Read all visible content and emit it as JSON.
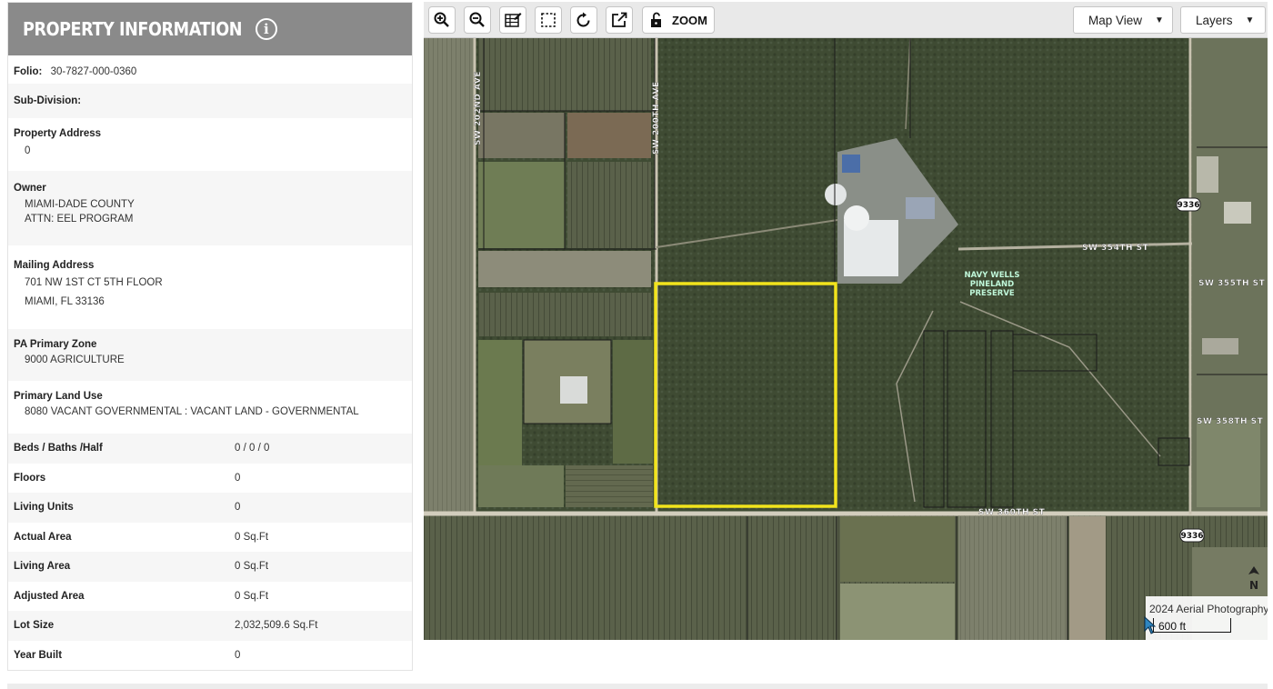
{
  "panel": {
    "title": "PROPERTY INFORMATION",
    "info_icon": "info-circle-icon",
    "folio_label": "Folio:",
    "folio_value": "30-7827-000-0360",
    "subdivision_label": "Sub-Division:",
    "property_address_label": "Property Address",
    "property_address_value": "0",
    "owner_label": "Owner",
    "owner_lines": [
      "MIAMI-DADE COUNTY",
      "ATTN: EEL PROGRAM"
    ],
    "mailing_label": "Mailing Address",
    "mailing_lines": [
      "701 NW 1ST CT 5TH FLOOR",
      "MIAMI, FL 33136"
    ],
    "zone_label": "PA Primary Zone",
    "zone_value": "9000 AGRICULTURE",
    "land_use_label": "Primary Land Use",
    "land_use_value": "8080 VACANT GOVERNMENTAL : VACANT LAND - GOVERNMENTAL",
    "details": [
      {
        "label": "Beds / Baths /Half",
        "value": "0 / 0 / 0"
      },
      {
        "label": "Floors",
        "value": "0"
      },
      {
        "label": "Living Units",
        "value": "0"
      },
      {
        "label": "Actual Area",
        "value": "0 Sq.Ft"
      },
      {
        "label": "Living Area",
        "value": "0 Sq.Ft"
      },
      {
        "label": "Adjusted Area",
        "value": "0 Sq.Ft"
      },
      {
        "label": "Lot Size",
        "value": "2,032,509.6 Sq.Ft"
      },
      {
        "label": "Year Built",
        "value": "0"
      }
    ]
  },
  "toolbar": {
    "icons": [
      "zoom-in-icon",
      "zoom-out-icon",
      "edit-table-icon",
      "select-box-icon",
      "refresh-icon",
      "external-link-icon",
      "unlock-icon"
    ],
    "zoom_label": "ZOOM",
    "map_view_label": "Map View",
    "layers_label": "Layers"
  },
  "map": {
    "road_labels": [
      "SW 202ND AVE",
      "SW 200TH AVE",
      "SW 354TH ST",
      "SW 355TH ST",
      "SW 358TH ST",
      "SW 360TH ST"
    ],
    "shield_labels": [
      "9336",
      "9336"
    ],
    "preserve_label": [
      "NAVY WELLS",
      "PINELAND",
      "PRESERVE"
    ],
    "scale_caption": "2024 Aerial Photography",
    "scale_value": "600 ft",
    "north_label": "N",
    "highlight_color": "#f2e41c",
    "forest_color": "#3f4b33"
  }
}
